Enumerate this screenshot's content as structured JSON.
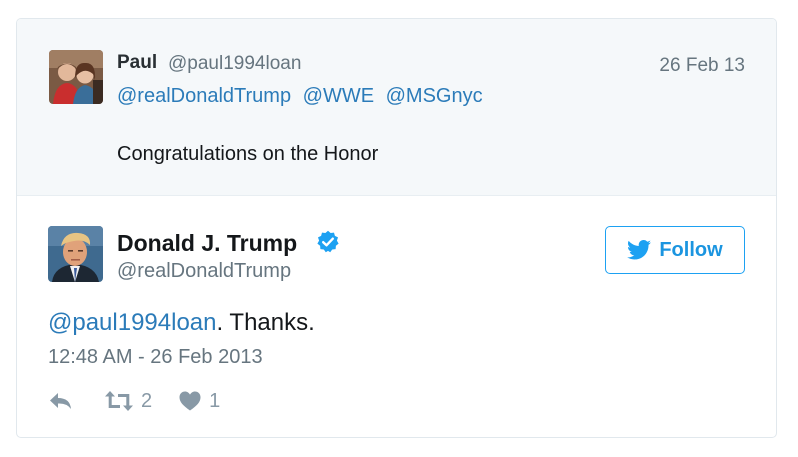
{
  "parent_tweet": {
    "author_name": "Paul",
    "author_handle": "@paul1994loan",
    "date": "26 Feb 13",
    "mentions": [
      "@realDonaldTrump",
      "@WWE",
      "@MSGnyc"
    ],
    "text": "Congratulations on the Honor"
  },
  "main_tweet": {
    "author_name": "Donald J. Trump",
    "author_handle": "@realDonaldTrump",
    "verified": true,
    "follow_label": "Follow",
    "body_mention": "@paul1994loan",
    "body_text": ". Thanks.",
    "timestamp": "12:48 AM - 26 Feb 2013",
    "retweet_count": "2",
    "like_count": "1"
  },
  "colors": {
    "link": "#2b7bb9",
    "accent": "#1da1f2",
    "muted": "#66757f",
    "icon": "#8899a6",
    "parent_bg": "#f5f8fa"
  },
  "icons": [
    "reply-icon",
    "retweet-icon",
    "heart-icon",
    "verified-badge-icon",
    "twitter-bird-icon"
  ]
}
